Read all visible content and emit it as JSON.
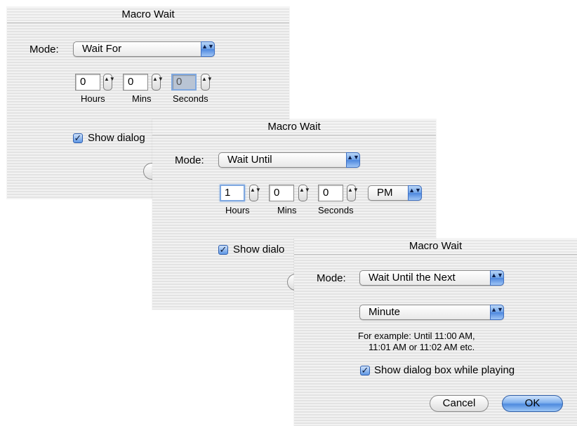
{
  "dialogs": [
    {
      "title": "Macro Wait",
      "mode_label": "Mode:",
      "mode_value": "Wait For",
      "hours": "0",
      "mins": "0",
      "seconds": "0",
      "hours_label": "Hours",
      "mins_label": "Mins",
      "seconds_label": "Seconds",
      "show_dialog_checked": true,
      "show_dialog_label_visible": "Show dialog"
    },
    {
      "title": "Macro Wait",
      "mode_label": "Mode:",
      "mode_value": "Wait Until",
      "hours": "1",
      "mins": "0",
      "seconds": "0",
      "hours_label": "Hours",
      "mins_label": "Mins",
      "seconds_label": "Seconds",
      "ampm": "PM",
      "show_dialog_checked": true,
      "show_dialog_label_visible": "Show dialo"
    },
    {
      "title": "Macro Wait",
      "mode_label": "Mode:",
      "mode_value": "Wait Until the Next",
      "unit_value": "Minute",
      "example_line1": "For example: Until 11:00 AM,",
      "example_line2": "11:01 AM or 11:02 AM etc.",
      "show_dialog_checked": true,
      "show_dialog_label": "Show dialog box while playing",
      "cancel_label": "Cancel",
      "ok_label": "OK"
    }
  ],
  "icons": {
    "popup_arrows": "▲▼",
    "stepper_arrows": "▲▼",
    "checkmark": "✓"
  },
  "colors": {
    "accent_blue": "#6fa3e8",
    "window_bg": "#ececec"
  }
}
